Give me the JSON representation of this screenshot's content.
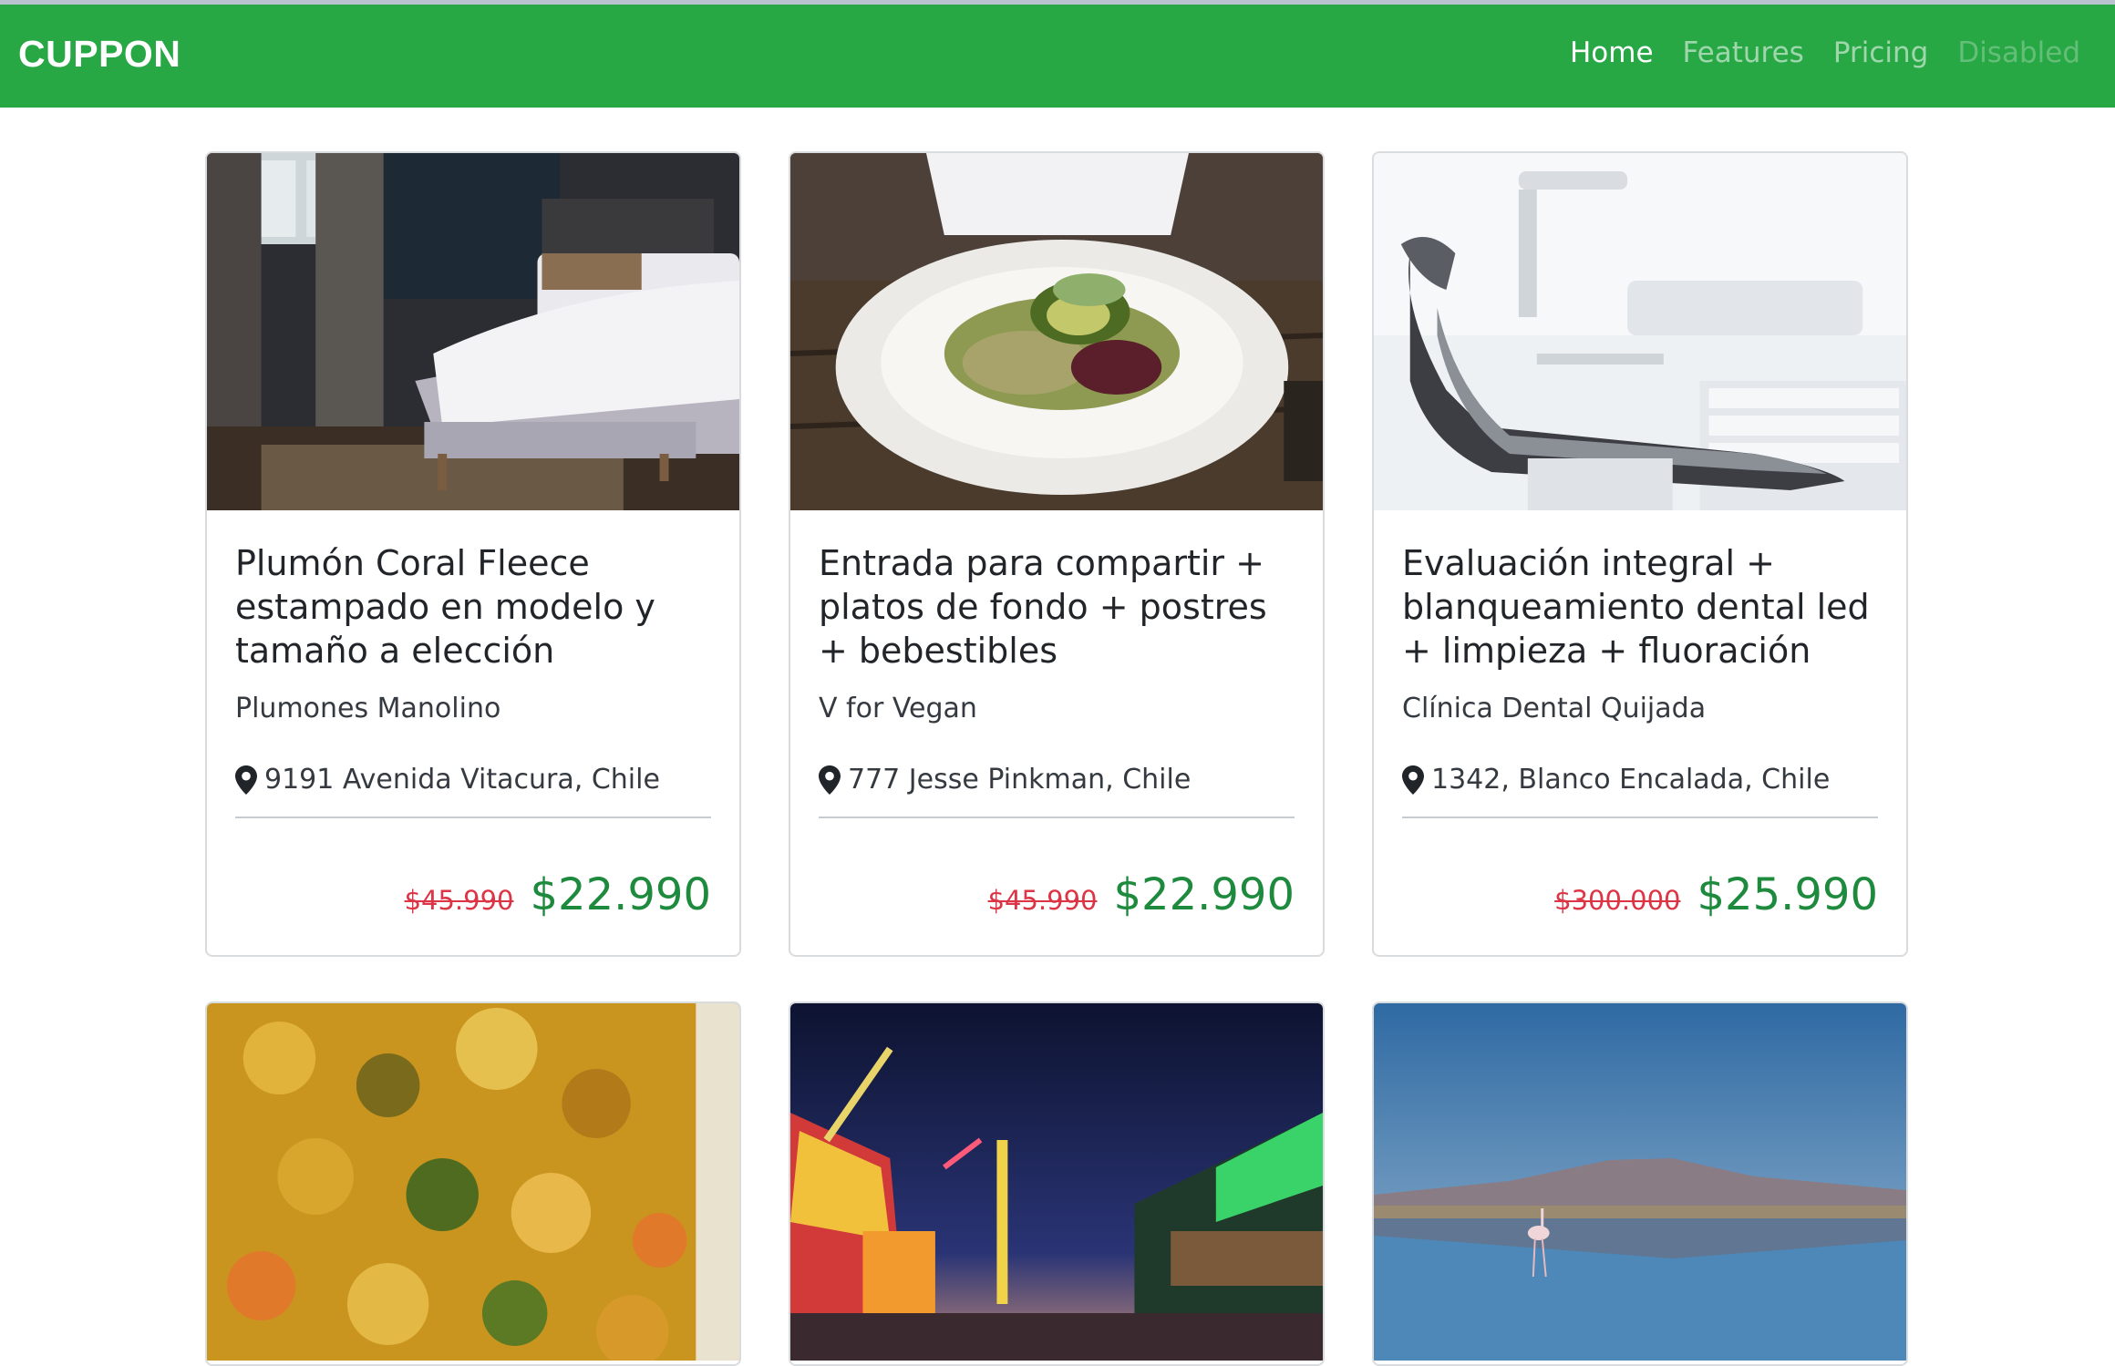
{
  "navbar": {
    "brand": "CUPPON",
    "links": [
      {
        "label": "Home",
        "state": "active"
      },
      {
        "label": "Features",
        "state": "normal"
      },
      {
        "label": "Pricing",
        "state": "normal"
      },
      {
        "label": "Disabled",
        "state": "disabled"
      }
    ],
    "color": "#28a745"
  },
  "cards": [
    {
      "title": "Plumón Coral Fleece estampado en modelo y tamaño a elección",
      "merchant": "Plumones Manolino",
      "location": "9191 Avenida Vitacura, Chile",
      "old_price": "$45.990",
      "new_price": "$22.990",
      "image": "bedroom-bed-photo"
    },
    {
      "title": "Entrada para compartir + platos de fondo + postres + bebestibles",
      "merchant": "V for Vegan",
      "location": "777 Jesse Pinkman, Chile",
      "old_price": "$45.990",
      "new_price": "$22.990",
      "image": "vegan-plate-photo"
    },
    {
      "title": "Evaluación integral + blanqueamiento dental led + limpieza + fluoración",
      "merchant": "Clínica Dental Quijada",
      "location": "1342, Blanco Encalada, Chile",
      "old_price": "$300.000",
      "new_price": "$25.990",
      "image": "dental-chair-photo"
    },
    {
      "image": "food-close-up-photo"
    },
    {
      "image": "night-fair-photo"
    },
    {
      "image": "flamingo-lake-photo"
    }
  ],
  "colors": {
    "old_price": "#dc3545",
    "new_price": "#1e8a3e"
  }
}
